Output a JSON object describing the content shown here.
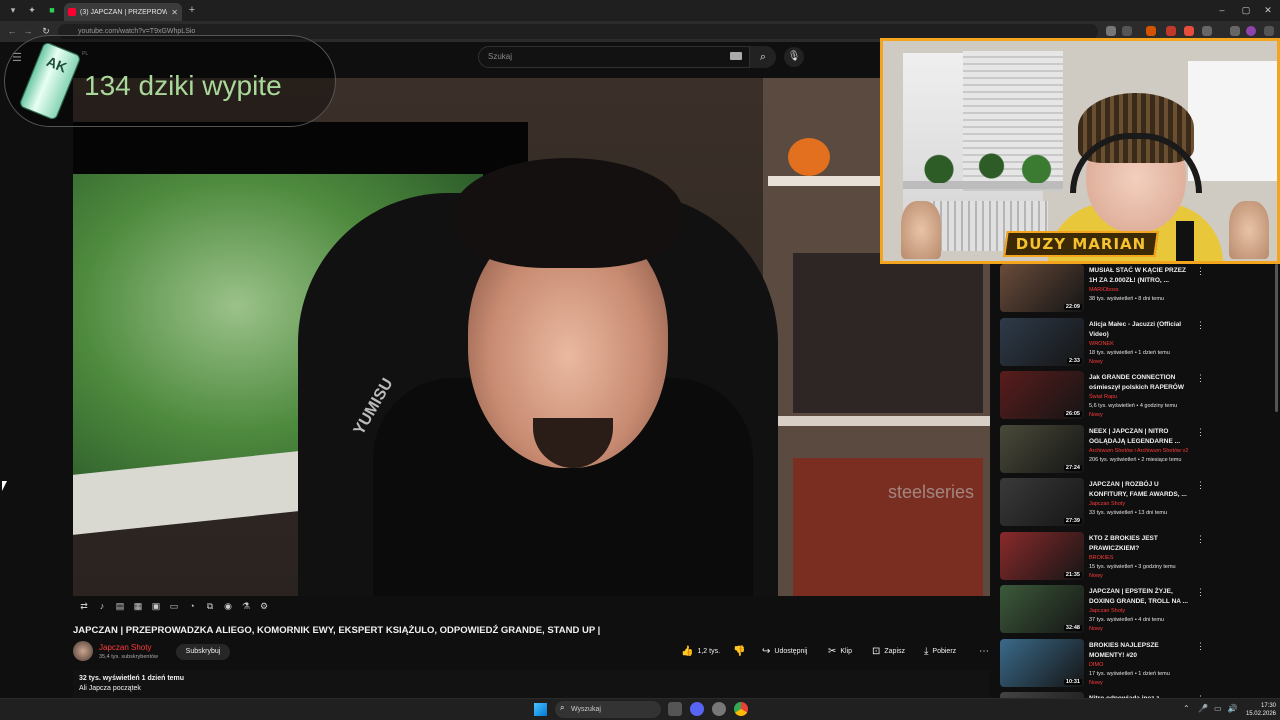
{
  "browser": {
    "tab_title": "(3) JAPCZAN | PRZEPROWA...",
    "url": "youtube.com/watch?v=T9xGWhpLSio"
  },
  "youtube": {
    "search_placeholder": "Szukaj",
    "logo_region": "PL"
  },
  "overlay": {
    "counter_text": "134 dziki wypite",
    "can_label": "AK"
  },
  "video": {
    "title": "JAPCZAN | PRZEPROWADZKA ALIEGO, KOMORNIK EWY, EKSPERT KSIĄŻULO, ODPOWIEDŹ GRANDE, STAND UP |",
    "channel": "Japczan Shoty",
    "subscribers": "35,4 tys. subskrybentów",
    "subscribe_label": "Subskrybuj",
    "likes": "1,2 tys.",
    "share_label": "Udostępnij",
    "clip_label": "Klip",
    "save_label": "Zapisz",
    "download_label": "Pobierz",
    "views_date": "32 tys. wyświetleń  1 dzień temu",
    "description": "Ali Japcza początek",
    "watermark_chair": "YUMISU",
    "watermark_box": "steelseries"
  },
  "webcam": {
    "banner": "DUZY MARIAN"
  },
  "recommendations": [
    {
      "title": "MUSIAŁ STAĆ W KĄCIE PRZEZ 1H ZA 2.000ZŁ! (NITRO, ...",
      "channel": "MARIOboss",
      "meta": "38 tys. wyświetleń • 8 dni temu",
      "duration": "22:09",
      "badge": "",
      "thumb": "#6a4b3a"
    },
    {
      "title": "Alicja Małec - Jacuzzi (Official Video)",
      "channel": "WRONEK",
      "meta": "18 tys. wyświetleń • 1 dzień temu",
      "duration": "2:33",
      "badge": "Nowy",
      "thumb": "#2e3a4a"
    },
    {
      "title": "Jak GRANDE CONNECTION ośmieszył polskich RAPERÓW",
      "channel": "Świat Rapu",
      "meta": "5,6 tys. wyświetleń • 4 godziny temu",
      "duration": "26:05",
      "badge": "Nowy",
      "thumb": "#5a1c1c"
    },
    {
      "title": "NEEX | JAPCZAN | NITRO OGLĄDAJĄ LEGENDARNE ...",
      "channel": "Archiwum Shotów i Archiwum Shotów v2",
      "meta": "206 tys. wyświetleń • 2 miesiące temu",
      "duration": "27:24",
      "badge": "",
      "thumb": "#4a4a3a"
    },
    {
      "title": "JAPCZAN | ROZBÓJ U KONFITURY, FAME AWARDS, ...",
      "channel": "Japczan Shoty",
      "meta": "33 tys. wyświetleń • 13 dni temu",
      "duration": "27:39",
      "badge": "",
      "thumb": "#3a3a3a"
    },
    {
      "title": "KTO Z BROKIES JEST PRAWICZKIEM?",
      "channel": "BROKIES",
      "meta": "15 tys. wyświetleń • 3 godziny temu",
      "duration": "21:35",
      "badge": "Nowy",
      "thumb": "#8a2a2a"
    },
    {
      "title": "JAPCZAN | EPSTEIN ŻYJE, DOXING GRANDE, TROLL NA ...",
      "channel": "Japczan Shoty",
      "meta": "37 tys. wyświetleń • 4 dni temu",
      "duration": "32:48",
      "badge": "Nowy",
      "thumb": "#3c5a3a"
    },
    {
      "title": "BROKIES NAJLEPSZE MOMENTY! #20",
      "channel": "DIMO",
      "meta": "17 tys. wyświetleń • 1 dzień temu",
      "duration": "10:31",
      "badge": "Nowy",
      "thumb": "#3a6a8a"
    },
    {
      "title": "Nitro odpowiada inez z ...",
      "channel": "",
      "meta": "",
      "duration": "",
      "badge": "",
      "thumb": "#444"
    }
  ],
  "taskbar": {
    "search_label": "Wyszukaj",
    "time": "17:30",
    "date": "15.02.2026"
  }
}
